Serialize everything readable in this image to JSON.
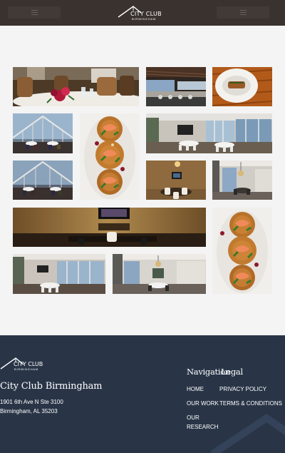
{
  "header": {
    "logo": {
      "name": "CITY CLUB",
      "sub": "BIRMINGHAM"
    }
  },
  "gallery": {
    "photos": [
      "dining-table-with-roses",
      "bar-with-stools",
      "plated-dish",
      "glass-conservatory-dining",
      "shrimp-fritters-plate",
      "banquet-hall-windows",
      "conservatory-dining-night",
      "private-dining-room",
      "round-table-room",
      "board-room-tv",
      "shrimp-fritters-plate-2",
      "event-room-windows",
      "round-table-event-room"
    ]
  },
  "footer": {
    "logo": {
      "name": "CITY CLUB",
      "sub": "BIRMINGHAM"
    },
    "title": "City Club Birmingham",
    "address_line1": "1901 6th Ave N Ste 3100",
    "address_line2": "Birmingham, AL 35203",
    "navigation": {
      "heading": "Navigation",
      "links": [
        "HOME",
        "OUR WORK",
        "OUR",
        "RESEARCH"
      ]
    },
    "legal": {
      "heading": "Legal",
      "links": [
        "PRIVACY POLICY",
        "TERMS & CONDITIONS"
      ]
    }
  },
  "colors": {
    "header_bg": "#3a322f",
    "page_bg": "#f4f4f4",
    "footer_bg": "#293547",
    "text_light": "#ffffff"
  }
}
